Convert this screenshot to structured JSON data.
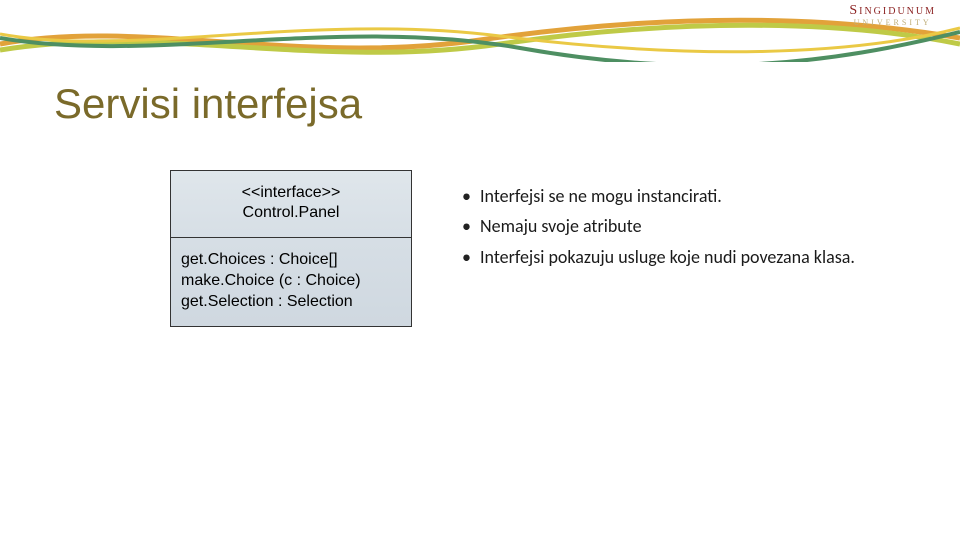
{
  "logo": {
    "main": "Singidunum",
    "sub": "University"
  },
  "slide_title": "Servisi interfejsa",
  "uml": {
    "stereotype": "<<interface>>",
    "name": "Control.Panel",
    "operations": "get.Choices : Choice[]\nmake.Choice (c : Choice)\nget.Selection : Selection"
  },
  "bullets": {
    "items": [
      "Interfejsi se ne mogu instancirati.",
      "Nemaju svoje atribute",
      "Interfejsi pokazuju usluge koje nudi povezana klasa."
    ]
  }
}
